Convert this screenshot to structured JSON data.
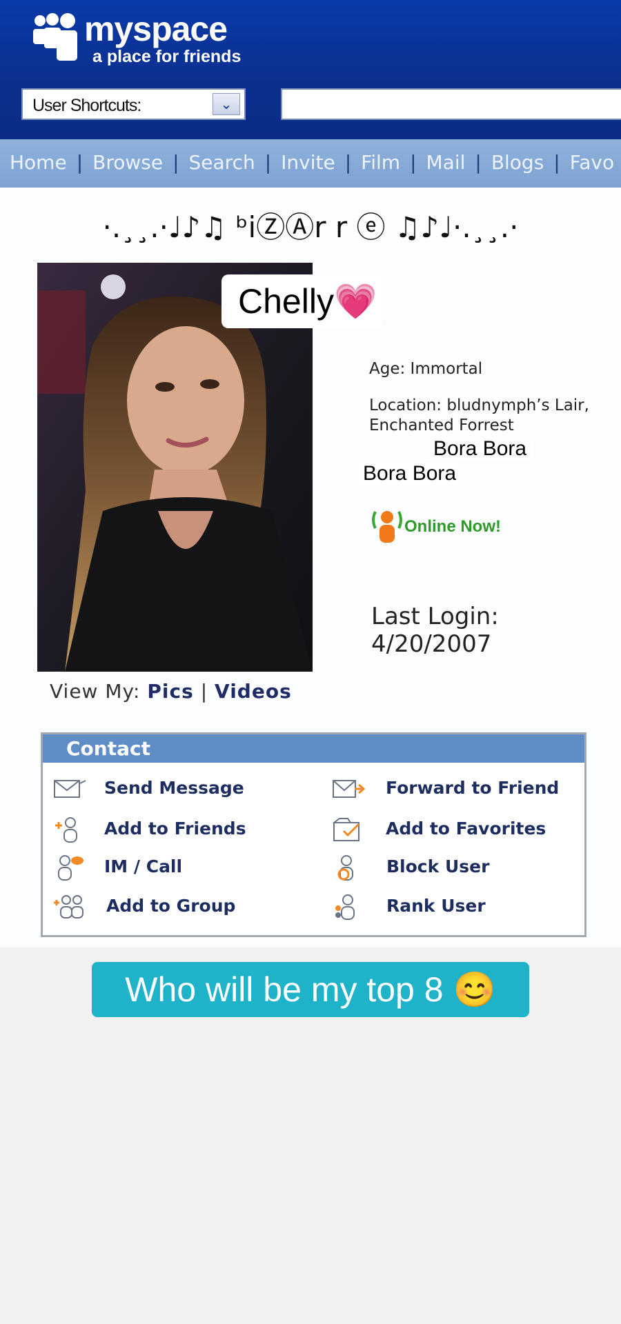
{
  "header": {
    "logo_word": "myspace",
    "logo_tagline": "a place for friends",
    "shortcuts_label": "User Shortcuts:",
    "shortcuts_arrow": "⌄"
  },
  "nav": {
    "items": [
      "Home",
      "Browse",
      "Search",
      "Invite",
      "Film",
      "Mail",
      "Blogs",
      "Favo"
    ],
    "separator": "|"
  },
  "profile": {
    "display_name": "·.¸¸.·♩♪♫ ᵇiⓏⒶr r ⓔ ♫♪♩·.¸¸.·",
    "overlay_name": "Chelly💗",
    "age": "Age: Immortal",
    "location_line1": "Location: bludnymph’s Lair,",
    "location_line2": "Enchanted Forrest",
    "bora_bora_1": "Bora Bora",
    "bora_bora_2": "Bora Bora",
    "online_status": "Online Now!",
    "last_login_label": "Last Login:",
    "last_login_date": "4/20/2007",
    "view_my_label": "View My:",
    "view_my_pics": "Pics",
    "view_my_sep": "|",
    "view_my_videos": "Videos"
  },
  "contact": {
    "title": "Contact",
    "actions": {
      "send_message": "Send Message",
      "forward_to_friend": "Forward to Friend",
      "add_to_friends": "Add to Friends",
      "add_to_favorites": "Add to Favorites",
      "im_call": "IM / Call",
      "block_user": "Block User",
      "add_to_group": "Add to Group",
      "rank_user": "Rank User"
    }
  },
  "caption": "Who will be my top 8 😊",
  "colors": {
    "header_blue": "#0b2f8e",
    "nav_blue": "#86a9d6",
    "contact_header": "#5e8dc8",
    "caption_bg": "#1fb3c9",
    "online_green": "#2f9a2a"
  }
}
